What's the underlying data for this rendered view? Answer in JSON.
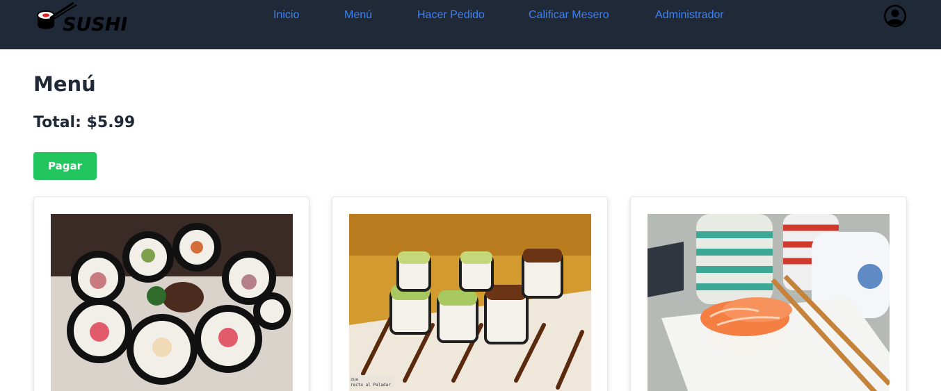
{
  "brand": {
    "name": "SUSHI"
  },
  "nav": {
    "items": [
      {
        "label": "Inicio"
      },
      {
        "label": "Menú"
      },
      {
        "label": "Hacer Pedido"
      },
      {
        "label": "Calificar Mesero"
      },
      {
        "label": "Administrador"
      }
    ],
    "user_icon": "user-circle-icon"
  },
  "main": {
    "title": "Menú",
    "total_label": "Total:",
    "total_value": "$5.99",
    "pay_label": "Pagar"
  },
  "menu": {
    "cards": [
      {
        "image": "sushi-maki-rolls-photo"
      },
      {
        "image": "avocado-eel-roll-photo",
        "caption_lines": [
          "zua",
          "recto al Paladar"
        ]
      },
      {
        "image": "salmon-nigiri-photo"
      }
    ]
  },
  "colors": {
    "navbar": "#1f2937",
    "link": "#3b82f6",
    "pay_button": "#22c55e",
    "text": "#1f2937"
  }
}
